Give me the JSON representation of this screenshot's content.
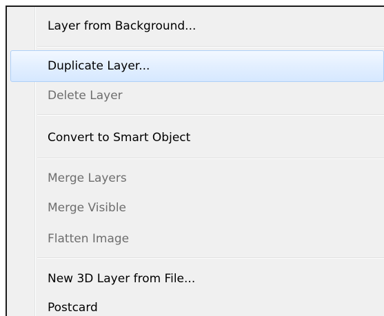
{
  "menu": {
    "items": [
      {
        "label": "Layer from Background...",
        "enabled": true
      },
      {
        "label": "Duplicate Layer...",
        "enabled": true,
        "highlighted": true
      },
      {
        "label": "Delete Layer",
        "enabled": false
      },
      {
        "label": "Convert to Smart Object",
        "enabled": true
      },
      {
        "label": "Merge Layers",
        "enabled": false
      },
      {
        "label": "Merge Visible",
        "enabled": false
      },
      {
        "label": "Flatten Image",
        "enabled": false
      },
      {
        "label": "New 3D Layer from File...",
        "enabled": true
      },
      {
        "label": "Postcard",
        "enabled": true
      }
    ]
  },
  "colors": {
    "menu_background": "#f0f0f0",
    "highlight_border": "#aecff7",
    "highlight_fill": "#e3efff",
    "enabled_text": "#000000",
    "disabled_text": "#6d6d6d"
  }
}
